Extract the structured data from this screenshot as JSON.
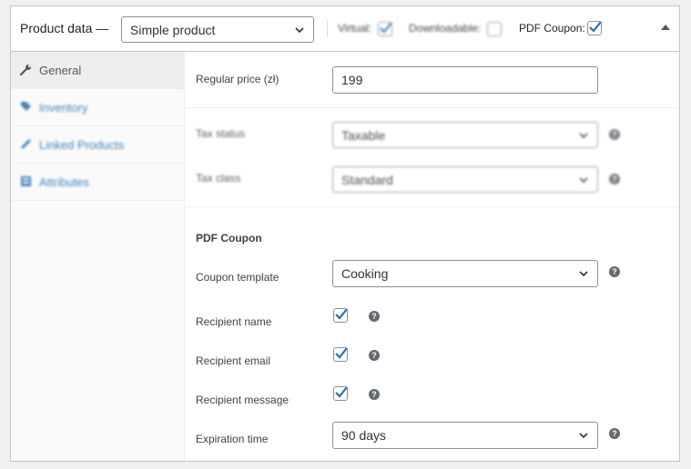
{
  "header": {
    "title": "Product data —",
    "product_type": "Simple product",
    "virtual_label": "Virtual:",
    "virtual_checked": true,
    "downloadable_label": "Downloadable:",
    "downloadable_checked": false,
    "pdf_coupon_label": "PDF Coupon:",
    "pdf_coupon_checked": true
  },
  "sidebar": {
    "items": [
      {
        "label": "General",
        "icon": "wrench-icon",
        "active": true
      },
      {
        "label": "Inventory",
        "icon": "tag-icon",
        "active": false
      },
      {
        "label": "Linked Products",
        "icon": "link-icon",
        "active": false
      },
      {
        "label": "Attributes",
        "icon": "table-icon",
        "active": false
      }
    ]
  },
  "general": {
    "regular_price_label": "Regular price (zł)",
    "regular_price_value": "199",
    "tax_status_label": "Tax status",
    "tax_status_value": "Taxable",
    "tax_class_label": "Tax class",
    "tax_class_value": "Standard"
  },
  "pdf_coupon": {
    "section_title": "PDF Coupon",
    "template_label": "Coupon template",
    "template_value": "Cooking",
    "recipient_name_label": "Recipient name",
    "recipient_name_checked": true,
    "recipient_email_label": "Recipient email",
    "recipient_email_checked": true,
    "recipient_message_label": "Recipient message",
    "recipient_message_checked": true,
    "expiration_label": "Expiration time",
    "expiration_value": "90 days"
  },
  "help_symbol": "?",
  "colors": {
    "accent": "#2271b1",
    "checkmark": "#2271b1",
    "border": "#8c8f94"
  }
}
